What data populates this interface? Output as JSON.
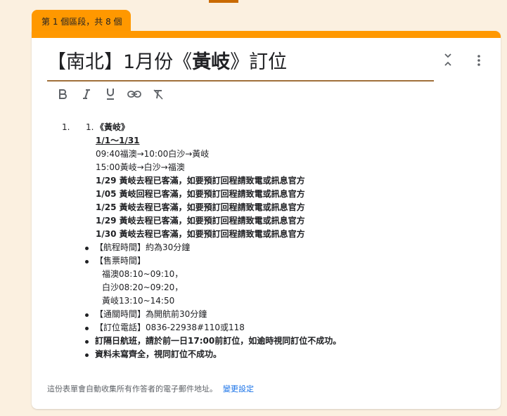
{
  "section_tab": "第 1 個區段，共 8 個",
  "title": {
    "prefix": "【南北】1月份《",
    "bold": "黃岐",
    "suffix": "》訂位"
  },
  "icons": {
    "collapse": "collapse-icon",
    "more": "more-vert-icon"
  },
  "toolbar": [
    "bold-icon",
    "italic-icon",
    "underline-icon",
    "link-icon",
    "clear-format-icon"
  ],
  "description": {
    "list_num_outer": "1.",
    "list_num_inner": "1.",
    "lines": [
      {
        "text": "《黃岐》",
        "bold": true
      },
      {
        "text": "1/1～1/31",
        "bold": true,
        "underline": true
      },
      {
        "text": "09:40福澳→10:00白沙→黃岐"
      },
      {
        "text": "15:00黃岐→白沙→福澳"
      },
      {
        "text": "1/29 黃岐去程已客滿，如要預訂回程請致電或訊息官方",
        "bold": true
      },
      {
        "text": "1/05 黃岐回程已客滿，如要預訂回程請致電或訊息官方",
        "bold": true
      },
      {
        "text": "1/25 黃岐去程已客滿，如要預訂回程請致電或訊息官方",
        "bold": true
      },
      {
        "text": "1/29 黃岐去程已客滿，如要預訂回程請致電或訊息官方",
        "bold": true
      },
      {
        "text": "1/30 黃岐去程已客滿，如要預訂回程請致電或訊息官方",
        "bold": true
      }
    ],
    "bullets": [
      {
        "text": "【航程時間】約為30分鐘"
      },
      {
        "text": "【售票時間】",
        "sub": [
          "福澳08:10~09:10，",
          "白沙08:20~09:20，",
          "黃岐13:10~14:50"
        ]
      },
      {
        "text": "【通關時間】為開航前30分鐘"
      },
      {
        "text": "【訂位電話】0836-22938#110或118"
      },
      {
        "text": "訂隔日航班，請於前一日17:00前訂位，如逾時視同訂位不成功。",
        "bold": true
      },
      {
        "text": "資料未寫齊全，視同訂位不成功。",
        "bold": true
      }
    ]
  },
  "footer": {
    "note": "這份表單會自動收集所有作答者的電子郵件地址。",
    "link": "變更設定"
  },
  "colors": {
    "accent": "#ff9800",
    "background": "#fbf0e0",
    "link": "#1a73e8",
    "title_underline": "#a0703a"
  }
}
